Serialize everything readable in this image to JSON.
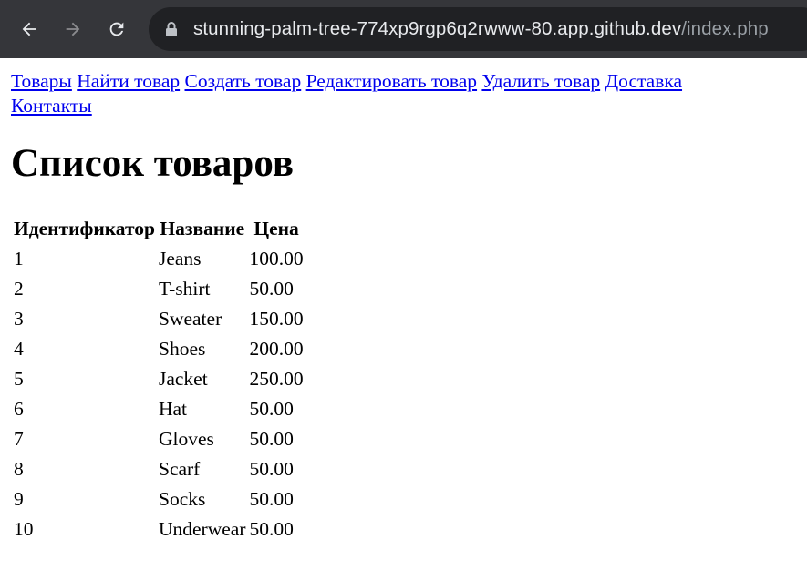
{
  "browser": {
    "url_host": "stunning-palm-tree-774xp9rgp6q2rwww-80.app.github.dev",
    "url_path": "/index.php",
    "back_icon": "arrow-left-icon",
    "forward_icon": "arrow-right-icon",
    "reload_icon": "reload-icon",
    "lock_icon": "lock-icon"
  },
  "nav": {
    "links": [
      "Товары",
      "Найти товар",
      "Создать товар",
      "Редактировать товар",
      "Удалить товар",
      "Доставка",
      "Контакты"
    ]
  },
  "heading": "Список товаров",
  "table": {
    "headers": [
      "Идентификатор",
      "Название",
      "Цена"
    ],
    "rows": [
      [
        "1",
        "Jeans",
        "100.00"
      ],
      [
        "2",
        "T-shirt",
        "50.00"
      ],
      [
        "3",
        "Sweater",
        "150.00"
      ],
      [
        "4",
        "Shoes",
        "200.00"
      ],
      [
        "5",
        "Jacket",
        "250.00"
      ],
      [
        "6",
        "Hat",
        "50.00"
      ],
      [
        "7",
        "Gloves",
        "50.00"
      ],
      [
        "8",
        "Scarf",
        "50.00"
      ],
      [
        "9",
        "Socks",
        "50.00"
      ],
      [
        "10",
        "Underwear",
        "50.00"
      ]
    ]
  },
  "colors": {
    "toolbar": "#35363a",
    "omnibox": "#202124",
    "link": "#0000ee"
  }
}
